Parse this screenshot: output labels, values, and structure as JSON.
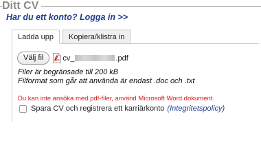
{
  "section": {
    "title": "Ditt CV"
  },
  "login": {
    "link_text": "Har du ett konto? Logga in >>"
  },
  "tabs": [
    {
      "label": "Ladda upp",
      "active": true
    },
    {
      "label": "Kopiera/klistra in",
      "active": false
    }
  ],
  "upload": {
    "choose_button": "Välj fil",
    "file_icon": "pdf-icon",
    "file_prefix": "cv_",
    "file_suffix": ".pdf",
    "size_limit": "Filer är begränsade till 200 kB",
    "format_note": "Filformat som går att använda är endast .doc och .txt"
  },
  "error": {
    "message": "Du kan inte ansöka med pdf-filer, använd Microsoft Word dokument.",
    "color": "#d21a1a"
  },
  "register": {
    "checkbox_label": "Spara CV och registrera ett karriärkonto",
    "checked": false,
    "privacy_link": "(Integritetspolicy)"
  },
  "colors": {
    "link": "#1f3d8c",
    "title": "#8a8a8a"
  }
}
